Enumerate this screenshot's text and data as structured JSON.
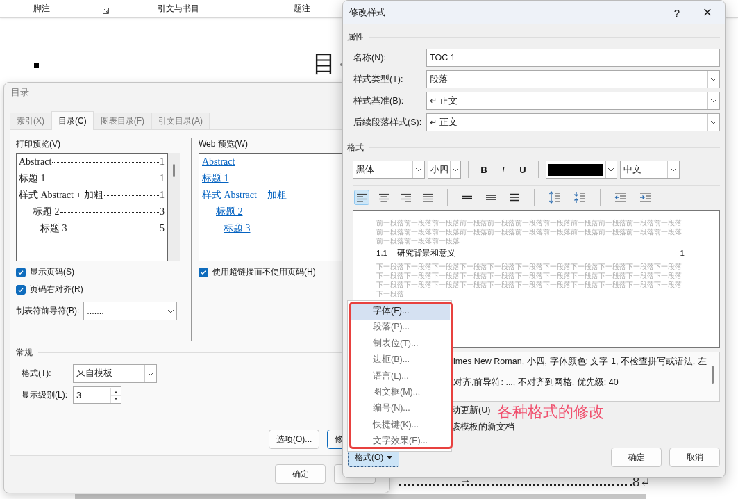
{
  "document": {
    "ribbon_groups": [
      {
        "label": "脚注",
        "launcher": true
      },
      {
        "label": "引文与书目",
        "launcher": false
      },
      {
        "label": "题注",
        "launcher": false
      }
    ],
    "heading": "目",
    "footer_arrow": "→",
    "footer_page": "8↵"
  },
  "toc_dialog": {
    "title": "目录",
    "tabs": [
      {
        "label": "索引(X)",
        "selected": false
      },
      {
        "label": "目录(C)",
        "selected": true
      },
      {
        "label": "图表目录(F)",
        "selected": false
      },
      {
        "label": "引文目录(A)",
        "selected": false
      }
    ],
    "print_preview": {
      "label": "打印预览(V)",
      "entries": [
        {
          "text": "Abstract",
          "page": "1"
        },
        {
          "text": "标题 1",
          "page": "1"
        },
        {
          "text": "样式 Abstract + 加粗",
          "page": "1",
          "children": [
            {
              "text": "标题 2",
              "page": "3",
              "children": [
                {
                  "text": "标题 3",
                  "page": "5"
                }
              ]
            }
          ]
        }
      ]
    },
    "web_preview": {
      "label": "Web 预览(W)",
      "entries": [
        {
          "text": "Abstract"
        },
        {
          "text": "标题 1"
        },
        {
          "text": "样式 Abstract + 加粗",
          "children": [
            {
              "text": "标题 2",
              "children": [
                {
                  "text": "标题 3"
                }
              ]
            }
          ]
        }
      ]
    },
    "checkboxes": [
      {
        "label": "显示页码(S)",
        "checked": true
      },
      {
        "label": "页码右对齐(R)",
        "checked": true
      }
    ],
    "hyperlink_checkbox": {
      "label": "使用超链接而不使用页码(H)",
      "checked": true
    },
    "tab_leader": {
      "label": "制表符前导符(B):",
      "value": "......."
    },
    "general": {
      "title": "常规",
      "format": {
        "label": "格式(T):",
        "value": "来自模板"
      },
      "levels": {
        "label": "显示级别(L):",
        "value": "3"
      }
    },
    "buttons": [
      "选项(O)...",
      "修"
    ],
    "footer_buttons": [
      "确定"
    ]
  },
  "style_dialog": {
    "title": "修改样式",
    "help": "?",
    "close": "×",
    "properties": {
      "title": "属性",
      "rows": [
        {
          "label": "名称(N):",
          "value": "TOC 1",
          "kind": "text"
        },
        {
          "label": "样式类型(T):",
          "value": "段落",
          "kind": "select"
        },
        {
          "label": "样式基准(B):",
          "value": "↵ 正文",
          "kind": "select"
        },
        {
          "label": "后续段落样式(S):",
          "value": "↵ 正文",
          "kind": "select"
        }
      ]
    },
    "format": {
      "title": "格式",
      "font": "黑体",
      "size": "小四",
      "style_buttons": [
        "B",
        "I",
        "U"
      ],
      "language": "中文"
    },
    "alignment": [
      {
        "kind": "align-left",
        "selected": true
      },
      {
        "kind": "align-center",
        "selected": false
      },
      {
        "kind": "align-right",
        "selected": false
      },
      {
        "kind": "justify",
        "selected": false
      }
    ],
    "preview": {
      "before": "前一段落前一段落前一段落前一段落前一段落前一段落前一段落前一段落前一段落前一段落前一段落前一段落前一段落前一段落前一段落前一段落前一段落前一段落前一段落前一段落前一段落前一段落前一段落前一段落前一段落",
      "number": "1.1",
      "title": "研究背景和意义",
      "page": "1",
      "after": "下一段落下一段落下一段落下一段落下一段落下一段落下一段落下一段落下一段落下一段落下一段落下一段落下一段落下一段落下一段落下一段落下一段落下一段落下一段落下一段落下一段落下一段落下一段落下一段落下一段落下一段落下一段落下一段落下一段落下一段落下一段落下一段落下一段落下一段落"
    },
    "description": [
      "imes New Roman, 小四, 字体颜色: 文字 1, 不检查拼写或语法, 左",
      "对齐,前导符: ..., 不对齐到网格, 优先级: 40"
    ],
    "options": [
      "动更新(U)",
      "该模板的新文档"
    ],
    "format_button": "格式(O)",
    "buttons": [
      "确定",
      "取消"
    ]
  },
  "format_menu": {
    "items": [
      {
        "label": "字体(F)...",
        "selected": true
      },
      {
        "label": "段落(P)...",
        "selected": false
      },
      {
        "label": "制表位(T)...",
        "selected": false
      },
      {
        "label": "边框(B)...",
        "selected": false
      },
      {
        "label": "语言(L)...",
        "selected": false
      },
      {
        "label": "图文框(M)...",
        "selected": false
      },
      {
        "label": "编号(N)...",
        "selected": false
      },
      {
        "label": "快捷键(K)...",
        "selected": false
      },
      {
        "label": "文字效果(E)...",
        "selected": false
      }
    ]
  },
  "annotation": "各种格式的修改"
}
